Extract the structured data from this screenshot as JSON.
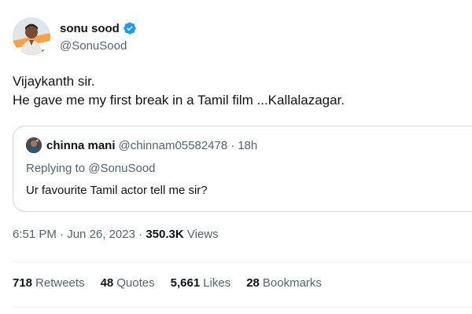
{
  "author": {
    "display_name": "sonu sood",
    "handle": "@SonuSood",
    "avatar_icon": "profile-photo",
    "verified_icon": "verified-badge-icon",
    "verified_color": "#1d9bf0"
  },
  "tweet": {
    "text": "Vijaykanth sir.\nHe gave me my first break in a Tamil film ...Kallalazagar."
  },
  "quoted": {
    "display_name": "chinna mani",
    "handle": "@chinnam05582478",
    "separator": "·",
    "time": "18h",
    "replying_prefix": "Replying to",
    "replying_to": "@SonuSood",
    "text": "Ur favourite Tamil actor tell me sir?"
  },
  "meta": {
    "time": "6:51 PM",
    "date": "Jun 26, 2023",
    "separator": "·",
    "views_count": "350.3K",
    "views_label": "Views"
  },
  "stats": {
    "retweets_count": "718",
    "retweets_label": "Retweets",
    "quotes_count": "48",
    "quotes_label": "Quotes",
    "likes_count": "5,661",
    "likes_label": "Likes",
    "bookmarks_count": "28",
    "bookmarks_label": "Bookmarks"
  },
  "colors": {
    "primary_text": "#0f1419",
    "secondary_text": "#536471",
    "border": "#cfd9de",
    "divider": "#eff3f4"
  }
}
